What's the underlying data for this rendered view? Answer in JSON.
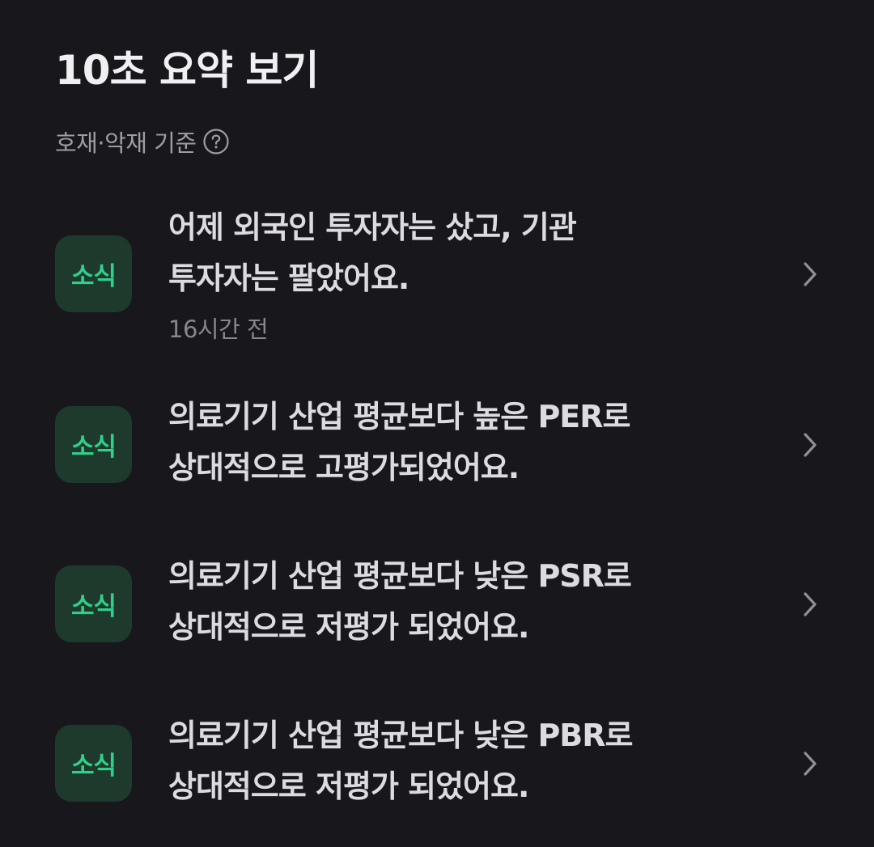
{
  "header": {
    "title": "10초 요약 보기",
    "criteria_label": "호재·악재 기준"
  },
  "icons": {
    "help": "help-circle-icon",
    "chevron": "chevron-right-icon"
  },
  "colors": {
    "background": "#18171c",
    "badge_bg": "#1d3a2d",
    "badge_text": "#2fd08a"
  },
  "news": [
    {
      "badge": "소식",
      "lines": [
        "어제 외국인 투자자는 샀고, 기관",
        "투자자는 팔았어요."
      ],
      "time": "16시간 전"
    },
    {
      "badge": "소식",
      "lines": [
        "의료기기 산업 평균보다 높은 PER로",
        "상대적으로 고평가되었어요."
      ]
    },
    {
      "badge": "소식",
      "lines": [
        "의료기기 산업 평균보다 낮은 PSR로",
        "상대적으로 저평가 되었어요."
      ]
    },
    {
      "badge": "소식",
      "lines": [
        "의료기기 산업 평균보다 낮은 PBR로",
        "상대적으로 저평가 되었어요."
      ]
    }
  ]
}
